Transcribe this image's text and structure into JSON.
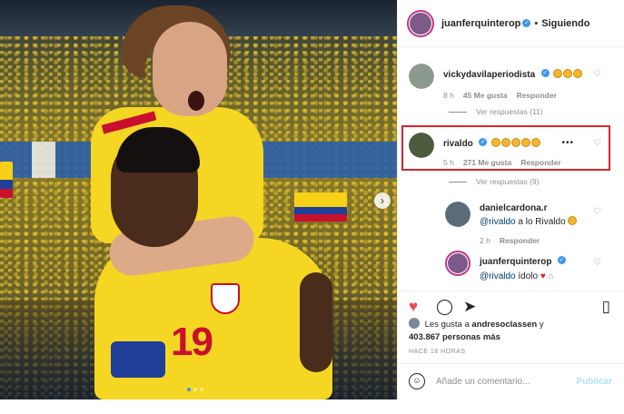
{
  "post": {
    "author": "juanferquinterop",
    "follow_state": "Siguiendo",
    "separator": "•"
  },
  "comments": [
    {
      "user": "vickydavilaperiodista",
      "emoji_count": 3,
      "time": "8 h",
      "likes": "45 Me gusta",
      "reply": "Responder",
      "view_replies": "Ver respuestas (11)"
    },
    {
      "user": "rivaldo",
      "emoji_count": 5,
      "more": "•••",
      "time": "5 h",
      "likes": "271 Me gusta",
      "reply": "Responder",
      "view_replies": "Ver respuestas (9)"
    },
    {
      "user": "danielcardona.r",
      "mention": "@rivaldo",
      "text": " a lo Rivaldo",
      "time": "2 h",
      "reply": "Responder"
    },
    {
      "user": "juanferquinterop",
      "mention": "@rivaldo",
      "text": " ídolo"
    }
  ],
  "likes": {
    "prefix": "Les gusta a",
    "user": "andresoclassen",
    "connector": "y",
    "others": "403.867 personas más"
  },
  "timestamp": "HACE 18 HORAS",
  "compose": {
    "placeholder": "Añade un comentario...",
    "post_label": "Publicar"
  },
  "photo": {
    "jersey_number": "19"
  },
  "colors": {
    "highlight": "#d7262d",
    "like": "#ed4956",
    "link": "#00376b",
    "verified": "#3897f0",
    "jersey": "#f5d623"
  },
  "icons": [
    "verified-icon",
    "heart-icon",
    "comment-icon",
    "share-icon",
    "bookmark-icon",
    "emoji-icon",
    "next-arrow-icon"
  ]
}
